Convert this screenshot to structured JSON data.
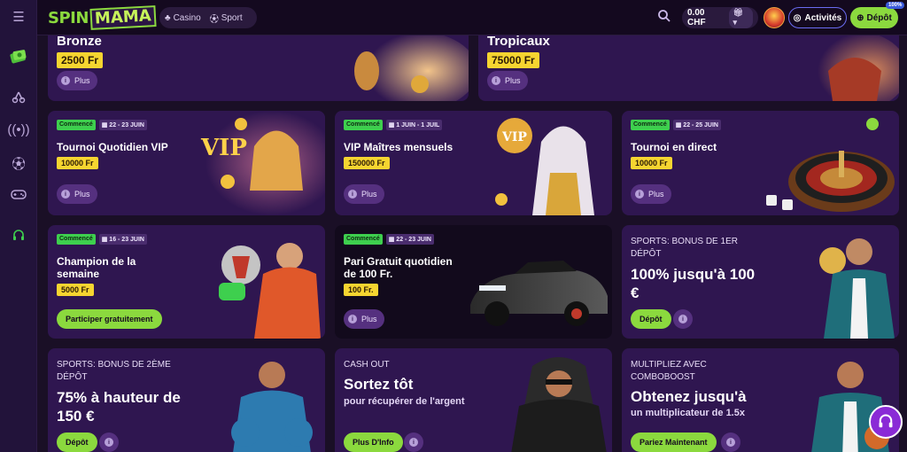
{
  "topbar": {
    "logo_spin": "SPIN",
    "logo_mama": "MAMA",
    "nav_casino": "Casino",
    "nav_sport": "Sport",
    "balance": "0.00 CHF",
    "activites": "Activités",
    "depot": "Dépôt",
    "badge": "100%"
  },
  "cards": {
    "bronze": {
      "title": "Bronze",
      "amount": "2500 Fr",
      "more": "Plus"
    },
    "tropicaux": {
      "title": "Tropicaux",
      "amount": "75000 Fr",
      "more": "Plus"
    },
    "vip_daily": {
      "status": "Commencé",
      "date": "22 - 23 JUIN",
      "title": "Tournoi Quotidien VIP",
      "amount": "10000 Fr",
      "more": "Plus"
    },
    "vip_monthly": {
      "status": "Commencé",
      "date": "1 JUIN - 1 JUIL",
      "title": "VIP Maîtres mensuels",
      "amount": "150000 Fr",
      "more": "Plus"
    },
    "live": {
      "status": "Commencé",
      "date": "22 - 25 JUIN",
      "title": "Tournoi en direct",
      "amount": "10000 Fr",
      "more": "Plus"
    },
    "champion": {
      "status": "Commencé",
      "date": "16 - 23 JUIN",
      "title_1": "Champion de la",
      "title_2": "semaine",
      "amount": "5000 Fr",
      "cta": "Participer gratuitement"
    },
    "freebet": {
      "status": "Commencé",
      "date": "22 - 23 JUIN",
      "title_1": "Pari Gratuit quotidien",
      "title_2": "de 100 Fr.",
      "amount": "100 Fr.",
      "more": "Plus"
    },
    "sports1": {
      "kicker_1": "SPORTS: BONUS DE 1ER",
      "kicker_2": "DÉPÔT",
      "big_1": "100% jusqu'à 100",
      "big_2": "€",
      "cta": "Dépôt"
    },
    "sports2": {
      "kicker_1": "SPORTS: BONUS DE 2ÈME",
      "kicker_2": "DÉPÔT",
      "big_1": "75% à hauteur de",
      "big_2": "150 €",
      "cta": "Dépôt"
    },
    "cashout": {
      "kicker_1": "CASH OUT",
      "big_1": "Sortez tôt",
      "sub_1": "pour récupérer de l'argent",
      "cta": "Plus D'Info"
    },
    "combo": {
      "kicker_1": "MULTIPLIEZ AVEC",
      "kicker_2": "COMBOBOOST",
      "big_1": "Obtenez jusqu'à",
      "sub_1": "un multiplicateur de 1.5x",
      "cta": "Pariez Maintenant"
    }
  }
}
